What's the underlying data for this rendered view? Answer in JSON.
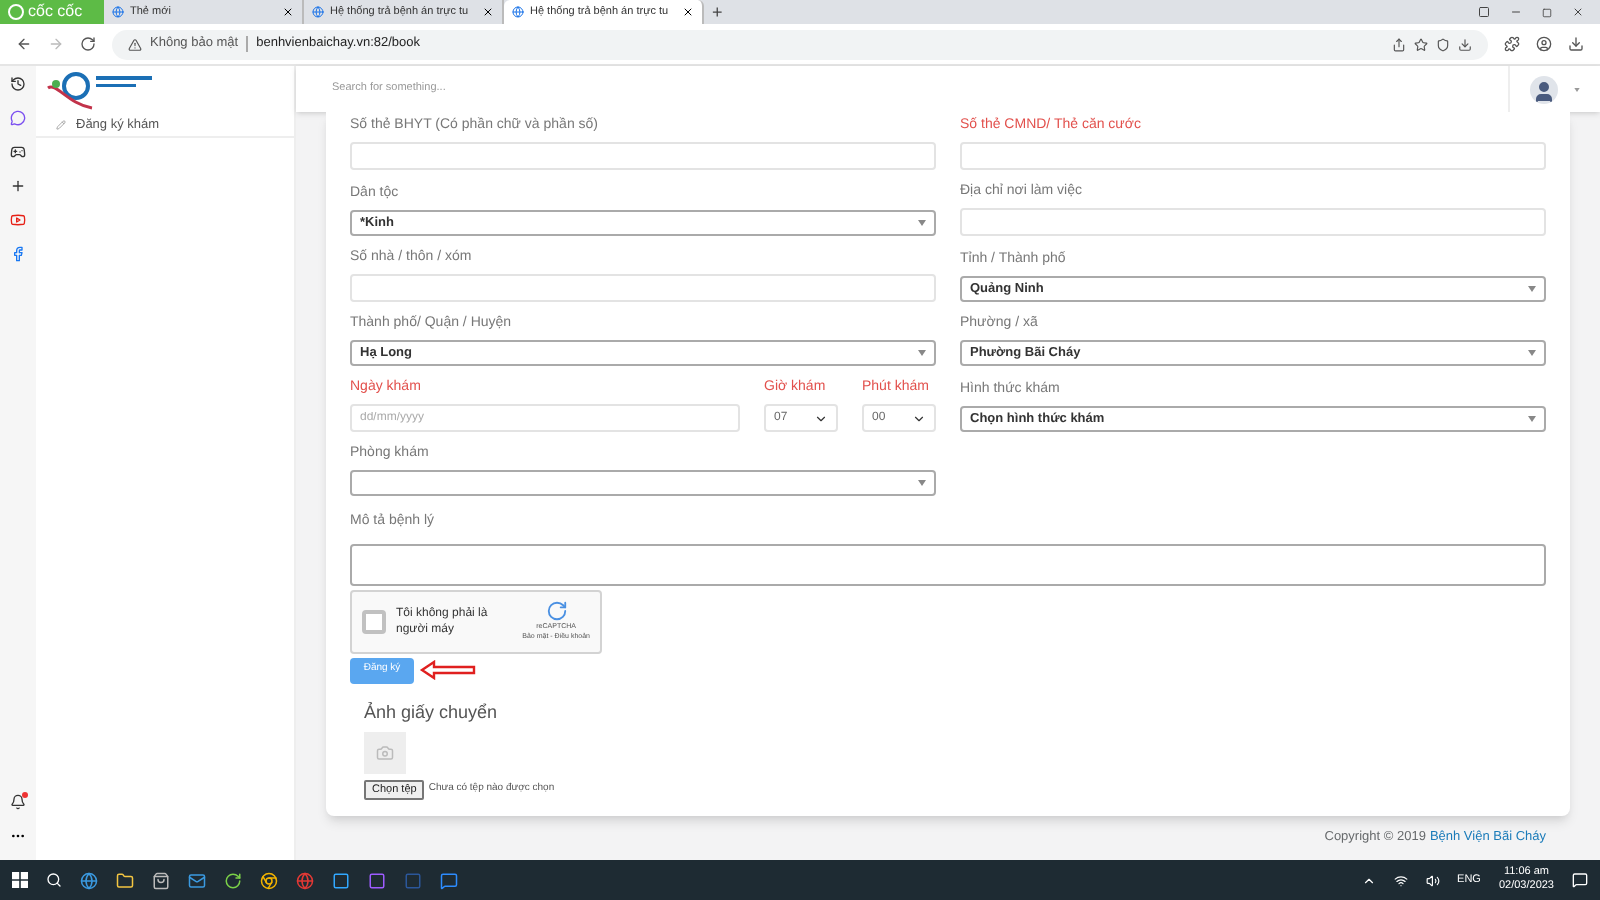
{
  "browser": {
    "brand": "cốc cốc",
    "tabs": [
      {
        "label": "Thẻ mới",
        "selected": false
      },
      {
        "label": "Hệ thống trả bệnh án trực tu",
        "selected": false
      },
      {
        "label": "Hệ thống trả bệnh án trực tu",
        "selected": true
      }
    ],
    "new_tab": "+",
    "security": "Không bảo mật",
    "url": "benhvienbaichay.vn:82/book"
  },
  "sidebar": {
    "items": [
      {
        "label": "Đăng ký khám"
      }
    ]
  },
  "header": {
    "search_placeholder": "Search for something..."
  },
  "form": {
    "rows": [
      {
        "left": [
          {
            "kind": "text",
            "label": "Số thẻ BHYT (Có phần chữ và phần số)",
            "required": false
          }
        ],
        "right": [
          {
            "kind": "text",
            "label": "Số thẻ CMND/ Thẻ căn cước",
            "required": true
          }
        ]
      },
      {
        "left": [
          {
            "kind": "select",
            "label": "Dân tộc",
            "required": false,
            "value": "*Kinh"
          }
        ],
        "right": [
          {
            "kind": "text",
            "label": "Địa chỉ nơi làm việc",
            "required": false
          }
        ]
      },
      {
        "left": [
          {
            "kind": "text",
            "label": "Số nhà / thôn / xóm",
            "required": false
          }
        ],
        "right": [
          {
            "kind": "select",
            "label": "Tỉnh / Thành phố",
            "required": false,
            "value": "Quảng Ninh"
          }
        ]
      },
      {
        "left": [
          {
            "kind": "select",
            "label": "Thành phố/ Quận / Huyện",
            "required": false,
            "value": "Hạ Long"
          }
        ],
        "right": [
          {
            "kind": "select",
            "label": "Phường / xã",
            "required": false,
            "value": "Phường Bãi Cháy"
          }
        ]
      },
      {
        "left": [
          {
            "kind": "text",
            "label": "Ngày khám",
            "required": true,
            "placeholder": "dd/mm/yyyy"
          },
          {
            "kind": "dropdown",
            "label": "Giờ khám",
            "required": true,
            "value": "07"
          },
          {
            "kind": "dropdown",
            "label": "Phút khám",
            "required": true,
            "value": "00"
          }
        ],
        "right": [
          {
            "kind": "select",
            "label": "Hình thức khám",
            "required": false,
            "value": "Chọn hình thức khám"
          }
        ]
      },
      {
        "left": [
          {
            "kind": "select",
            "label": "Phòng khám",
            "required": false
          }
        ],
        "right": []
      }
    ],
    "description": {
      "label": "Mô tả bệnh lý"
    },
    "captcha": {
      "label": "Tôi không phải là người máy",
      "checked": false,
      "brand": "reCAPTCHA",
      "links": "Bảo mật - Điều khoản"
    },
    "submit": "Đăng ký",
    "upload": {
      "title": "Ảnh giấy chuyển",
      "button": "Chọn tệp",
      "status": "Chưa có tệp nào được chọn"
    }
  },
  "footer": {
    "text": "Copyright © 2019",
    "link": "Bệnh Viện Bãi Cháy"
  },
  "taskbar": {
    "language": "ENG",
    "time": "11:06 am",
    "date": "02/03/2023"
  }
}
